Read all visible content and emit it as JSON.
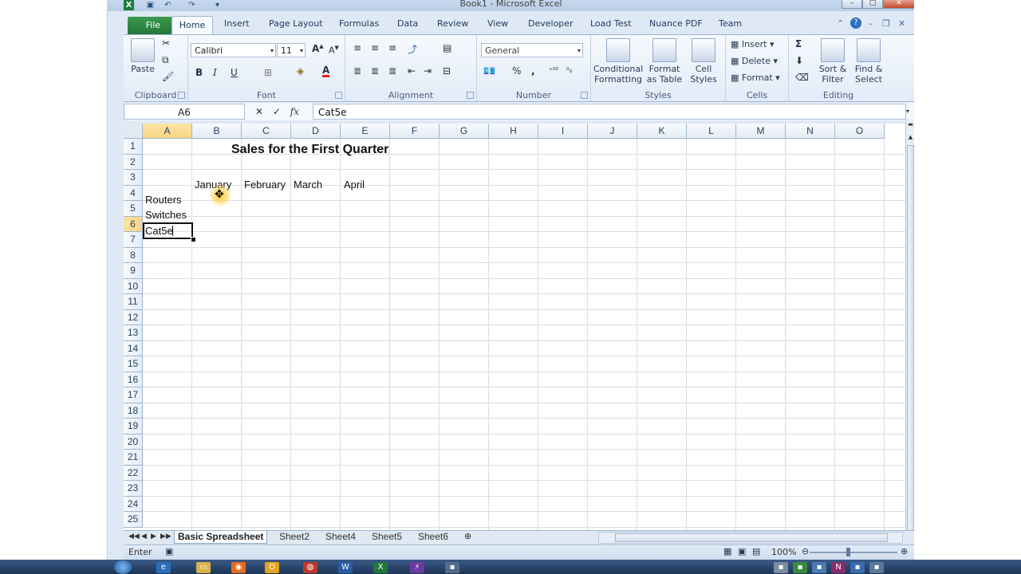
{
  "window": {
    "title": "Book1 - Microsoft Excel"
  },
  "titlebar": {
    "app_logo": "X"
  },
  "ribbon_tabs": {
    "file": "File",
    "tabs": [
      "Home",
      "Insert",
      "Page Layout",
      "Formulas",
      "Data",
      "Review",
      "View",
      "Developer",
      "Load Test",
      "Nuance PDF",
      "Team"
    ],
    "active": "Home"
  },
  "clipboard": {
    "paste": "Paste",
    "label": "Clipboard"
  },
  "font": {
    "name": "Calibri",
    "size": "11",
    "bold": "B",
    "italic": "I",
    "underline": "U",
    "label": "Font"
  },
  "alignment": {
    "label": "Alignment"
  },
  "number": {
    "format": "General",
    "percent": "%",
    "comma": ",",
    "label": "Number"
  },
  "styles": {
    "conditional_1": "Conditional",
    "conditional_2": "Formatting",
    "format_table_1": "Format",
    "format_table_2": "as Table",
    "cell_styles_1": "Cell",
    "cell_styles_2": "Styles",
    "label": "Styles"
  },
  "cells": {
    "insert": "Insert",
    "delete": "Delete",
    "format": "Format",
    "label": "Cells"
  },
  "editing": {
    "sort_1": "Sort &",
    "sort_2": "Filter",
    "find_1": "Find &",
    "find_2": "Select",
    "sigma": "Σ",
    "label": "Editing"
  },
  "formula_bar": {
    "name_box": "A6",
    "fx": "fx",
    "value": "Cat5e"
  },
  "grid": {
    "columns": [
      "A",
      "B",
      "C",
      "D",
      "E",
      "F",
      "G",
      "H",
      "I",
      "J",
      "K",
      "L",
      "M",
      "N",
      "O"
    ],
    "rows": [
      "1",
      "2",
      "3",
      "4",
      "5",
      "6",
      "7",
      "8",
      "9",
      "10",
      "11",
      "12",
      "13",
      "14",
      "15",
      "16",
      "17",
      "18",
      "19",
      "20",
      "21",
      "22",
      "23",
      "24",
      "25"
    ],
    "selected_column": "A",
    "selected_row": "6",
    "cells": {
      "title": "Sales for the First Quarter",
      "b3": "January",
      "c3": "February",
      "d3": "March",
      "e3": "April",
      "a4": "Routers",
      "a5": "Switches",
      "a6": "Cat5e"
    }
  },
  "sheet_tabs": [
    "Basic Spreadsheet",
    "Sheet2",
    "Sheet4",
    "Sheet5",
    "Sheet6"
  ],
  "active_sheet": "Basic Spreadsheet",
  "status": {
    "mode": "Enter",
    "zoom": "100%"
  },
  "colors": {
    "excel_green": "#23773a",
    "selection_header": "#f8d584",
    "ribbon_bg": "#e2ebf7"
  }
}
